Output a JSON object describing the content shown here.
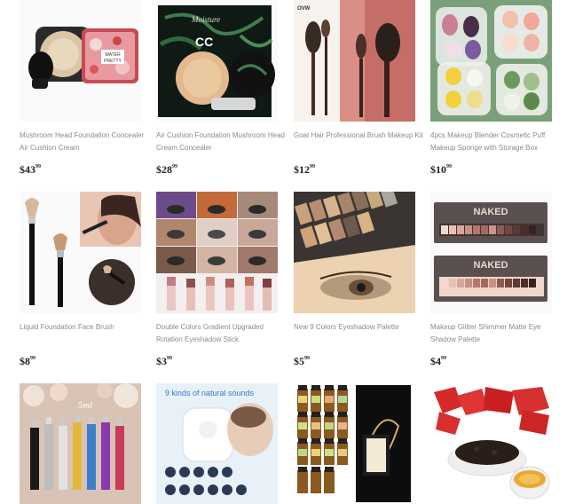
{
  "products": [
    {
      "title": "Mushroom Head Foundation Concealer Air Cushion Cream",
      "currency": "$",
      "dollars": "43",
      "cents": "99",
      "image": "mushroom-cushion-compact"
    },
    {
      "title": "Air Cushion Foundation Mushroom Head Cream Concealer",
      "currency": "$",
      "dollars": "28",
      "cents": "99",
      "image": "moisture-cushion-box"
    },
    {
      "title": "Goat Hair Professional Brush Makeup Kit",
      "currency": "$",
      "dollars": "12",
      "cents": "99",
      "image": "goat-hair-brushes",
      "brand": "OVW"
    },
    {
      "title": "4pcs Makeup Blender Cosmetic Puff Makeup Sponge with Storage Box",
      "currency": "$",
      "dollars": "10",
      "cents": "99",
      "image": "sponge-storage-box"
    },
    {
      "title": "Liquid Foundation Face Brush",
      "currency": "$",
      "dollars": "8",
      "cents": "99",
      "image": "foundation-brush"
    },
    {
      "title": "Double Colors Gradient Upgraded Rotation Eyeshadow Stick",
      "currency": "$",
      "dollars": "3",
      "cents": "99",
      "image": "eyeshadow-stick-collage"
    },
    {
      "title": "New 9 Colors Eyeshadow Palette",
      "currency": "$",
      "dollars": "5",
      "cents": "99",
      "image": "glitter-palette"
    },
    {
      "title": "Makeup Glitter Shimmer Matte Eye Shadow Palette",
      "currency": "$",
      "dollars": "4",
      "cents": "99",
      "image": "naked-palettes",
      "brand": "NAKED"
    },
    {
      "title": "",
      "image": "perfume-atomizers",
      "overlay": "5ml"
    },
    {
      "title": "",
      "image": "white-noise-machine",
      "overlay": "9 kinds of natural sounds"
    },
    {
      "title": "",
      "image": "essential-oils-set"
    },
    {
      "title": "",
      "image": "tea-leaves"
    }
  ]
}
